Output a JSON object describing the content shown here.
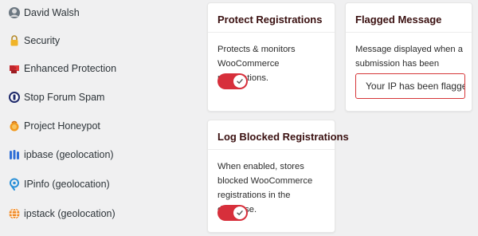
{
  "sidebar": {
    "items": [
      {
        "label": "David Walsh",
        "icon": "profile-pic-icon"
      },
      {
        "label": "Security",
        "icon": "lock-icon"
      },
      {
        "label": "Enhanced Protection",
        "icon": "puzzle-icon"
      },
      {
        "label": "Stop Forum Spam",
        "icon": "stop-forum-spam-icon"
      },
      {
        "label": "Project Honeypot",
        "icon": "honeypot-icon"
      },
      {
        "label": "ipbase (geolocation)",
        "icon": "bars-icon"
      },
      {
        "label": "IPinfo (geolocation)",
        "icon": "location-pin-icon"
      },
      {
        "label": "ipstack (geolocation)",
        "icon": "globe-icon"
      }
    ]
  },
  "cards": {
    "protect": {
      "title": "Protect Registrations",
      "description": "Protects & monitors WooCommerce registrations.",
      "enabled": true
    },
    "flagged": {
      "title": "Flagged Message",
      "description": "Message displayed when a submission has been flagged.",
      "value": "Your IP has been flagged"
    },
    "log": {
      "title": "Log Blocked Registrations",
      "description": "When enabled, stores blocked WooCommerce registrations in the database.",
      "enabled": true
    }
  },
  "colors": {
    "toggle_on": "#d72f3b",
    "title_text": "#3a1010",
    "page_bg": "#f0f0f1"
  }
}
